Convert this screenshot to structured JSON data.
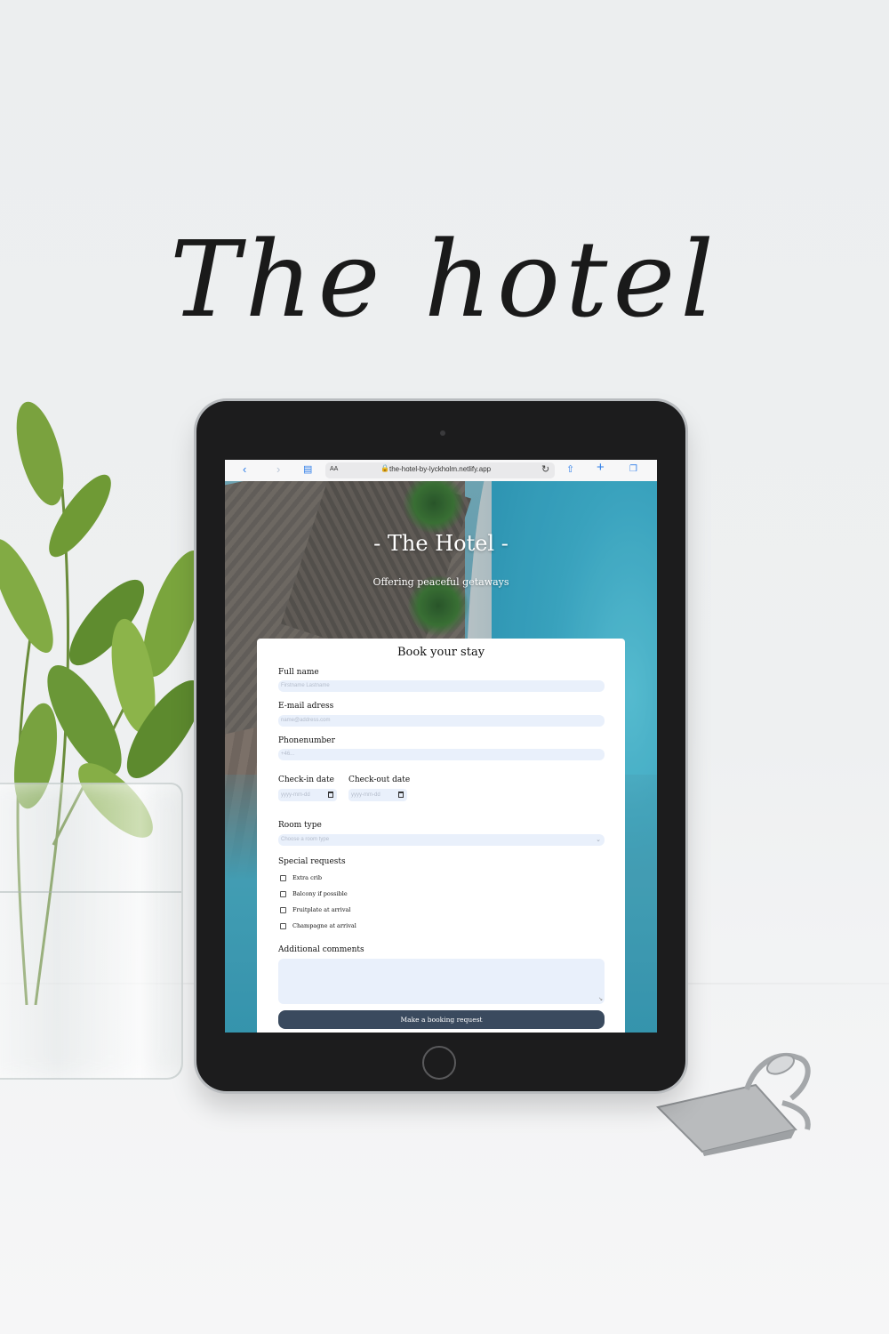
{
  "headline": "The hotel",
  "browser": {
    "text_size_label": "AA",
    "url": "the-hotel-by-lyckholm.netlify.app",
    "icons": [
      "back-icon",
      "forward-icon",
      "bookmarks-icon",
      "lock-icon",
      "reload-icon",
      "share-icon",
      "new-tab-icon",
      "tabs-icon"
    ]
  },
  "hero": {
    "title": "- The Hotel -",
    "subtitle": "Offering peaceful getaways"
  },
  "form": {
    "title": "Book your stay",
    "full_name": {
      "label": "Full name",
      "placeholder": "Firstname Lastname"
    },
    "email": {
      "label": "E-mail adress",
      "placeholder": "name@address.com"
    },
    "phone": {
      "label": "Phonenumber",
      "placeholder": "+46..."
    },
    "checkin": {
      "label": "Check-in date",
      "placeholder": "yyyy-mm-dd"
    },
    "checkout": {
      "label": "Check-out date",
      "placeholder": "yyyy-mm-dd"
    },
    "room_type": {
      "label": "Room type",
      "selected": "Choose a room type"
    },
    "special_requests": {
      "label": "Special requests",
      "options": [
        "Extra crib",
        "Balcony if possible",
        "Fruitplate at arrival",
        "Champagne at arrival"
      ]
    },
    "comments": {
      "label": "Additional comments"
    },
    "submit_label": "Make a booking request"
  },
  "colors": {
    "button": "#3a4a5e",
    "input_bg": "#e9f0fb",
    "browser_accent": "#2f7ee8"
  }
}
